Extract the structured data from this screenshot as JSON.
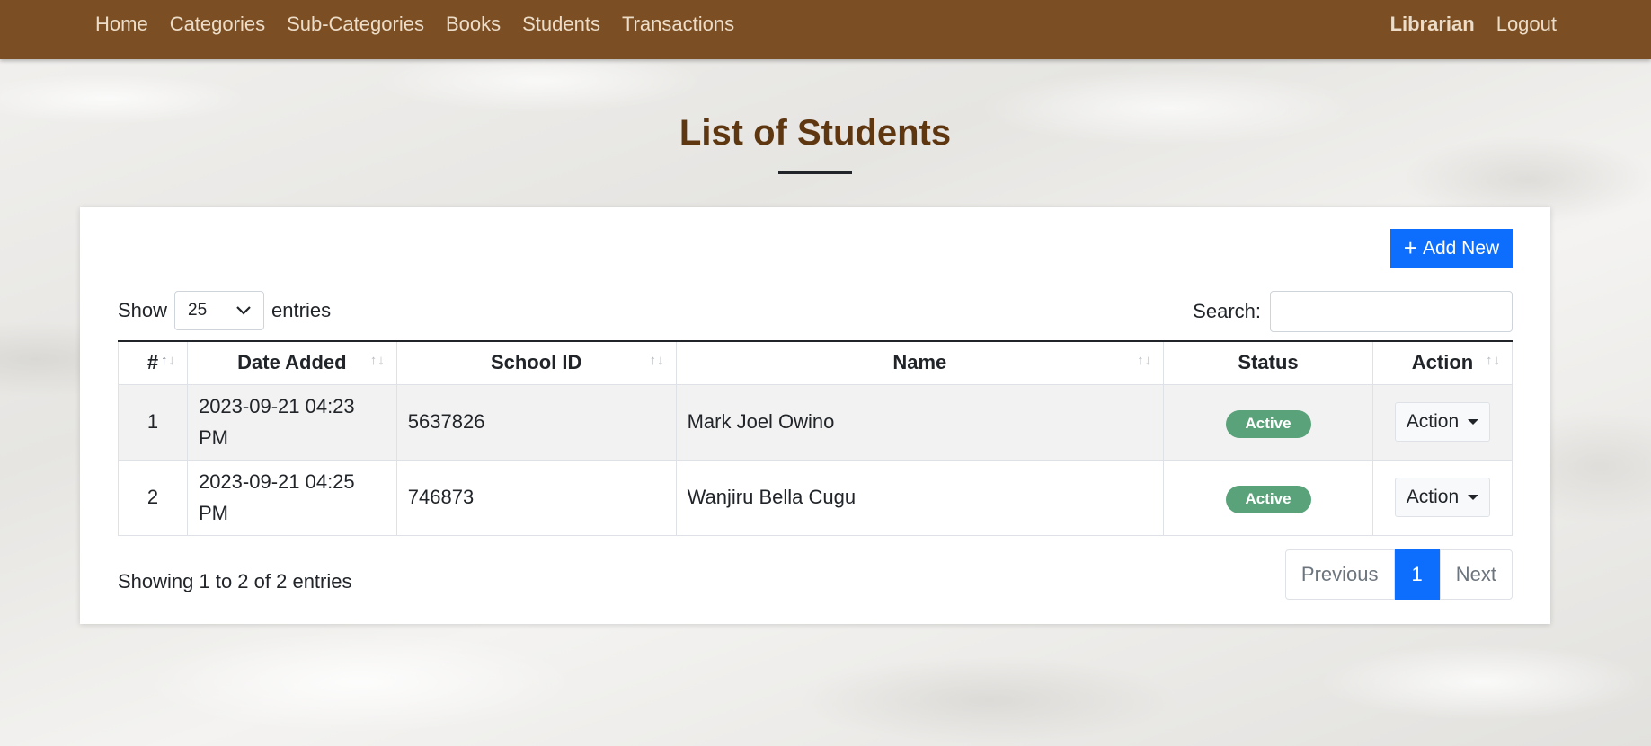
{
  "nav": {
    "items": [
      "Home",
      "Categories",
      "Sub-Categories",
      "Books",
      "Students",
      "Transactions"
    ],
    "user": "Librarian",
    "logout": "Logout"
  },
  "page": {
    "title": "List of Students"
  },
  "toolbar": {
    "add_new_label": "Add New",
    "add_icon": "plus-icon"
  },
  "length": {
    "show_label": "Show",
    "value": "25",
    "entries_label": "entries"
  },
  "search": {
    "label": "Search:",
    "value": "",
    "placeholder": ""
  },
  "table": {
    "columns": [
      "#",
      "Date Added",
      "School ID",
      "Name",
      "Status",
      "Action"
    ],
    "rows": [
      {
        "num": "1",
        "date_added": "2023-09-21 04:23 PM",
        "school_id": "5637826",
        "name": "Mark Joel Owino",
        "status": "Active",
        "action": "Action"
      },
      {
        "num": "2",
        "date_added": "2023-09-21 04:25 PM",
        "school_id": "746873",
        "name": "Wanjiru Bella Cugu",
        "status": "Active",
        "action": "Action"
      }
    ]
  },
  "footer": {
    "info": "Showing 1 to 2 of 2 entries",
    "previous": "Previous",
    "current_page": "1",
    "next": "Next"
  },
  "colors": {
    "navbar": "#7b4f23",
    "title": "#5e3711",
    "primary": "#0d6efd",
    "status_active": "#5aa37a"
  }
}
